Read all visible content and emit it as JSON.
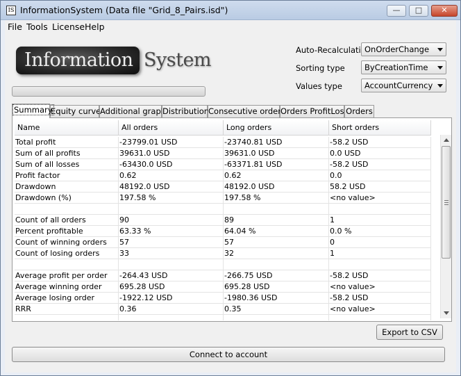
{
  "window": {
    "icon_text": "IS",
    "title": "InformationSystem (Data file \"Grid_8_Pairs.isd\")",
    "minimize_glyph": "—",
    "maximize_glyph": "□",
    "close_glyph": "✕"
  },
  "menu": [
    "File",
    "Tools",
    "License",
    "Help"
  ],
  "logo": {
    "part1": "Information",
    "part2": "System"
  },
  "progress": {
    "value": 0
  },
  "options": [
    {
      "label": "Auto-Recalculating",
      "value": "OnOrderChange"
    },
    {
      "label": "Sorting type",
      "value": "ByCreationTime"
    },
    {
      "label": "Values type",
      "value": "AccountCurrency"
    }
  ],
  "tabs": [
    "Summary",
    "Equity curve",
    "Additional graph",
    "Distribution",
    "Consecutive orders",
    "Orders ProfitLoss",
    "Orders"
  ],
  "active_tab": "Summary",
  "table": {
    "columns": [
      "Name",
      "All orders",
      "Long orders",
      "Short orders"
    ],
    "rows": [
      [
        "Total profit",
        "-23799.01 USD",
        "-23740.81 USD",
        "-58.2 USD"
      ],
      [
        "Sum of all profits",
        "39631.0 USD",
        "39631.0 USD",
        "0.0 USD"
      ],
      [
        "Sum of all losses",
        "-63430.0 USD",
        "-63371.81 USD",
        "-58.2 USD"
      ],
      [
        "Profit factor",
        "0.62",
        "0.62",
        "0.0"
      ],
      [
        "Drawdown",
        "48192.0 USD",
        "48192.0 USD",
        "58.2 USD"
      ],
      [
        "Drawdown (%)",
        "197.58 %",
        "197.58 %",
        "<no value>"
      ],
      [
        "",
        "",
        "",
        ""
      ],
      [
        "Count of all orders",
        "90",
        "89",
        "1"
      ],
      [
        "Percent profitable",
        "63.33 %",
        "64.04 %",
        "0.0 %"
      ],
      [
        "Count of winning orders",
        "57",
        "57",
        "0"
      ],
      [
        "Count of losing orders",
        "33",
        "32",
        "1"
      ],
      [
        "",
        "",
        "",
        ""
      ],
      [
        "Average profit per order",
        "-264.43 USD",
        "-266.75 USD",
        "-58.2 USD"
      ],
      [
        "Average winning order",
        "695.28 USD",
        "695.28 USD",
        "<no value>"
      ],
      [
        "Average losing order",
        "-1922.12 USD",
        "-1980.36 USD",
        "-58.2 USD"
      ],
      [
        "RRR",
        "0.36",
        "0.35",
        "<no value>"
      ],
      [
        "",
        "",
        "",
        ""
      ]
    ]
  },
  "buttons": {
    "export": "Export to CSV",
    "connect": "Connect to account"
  }
}
